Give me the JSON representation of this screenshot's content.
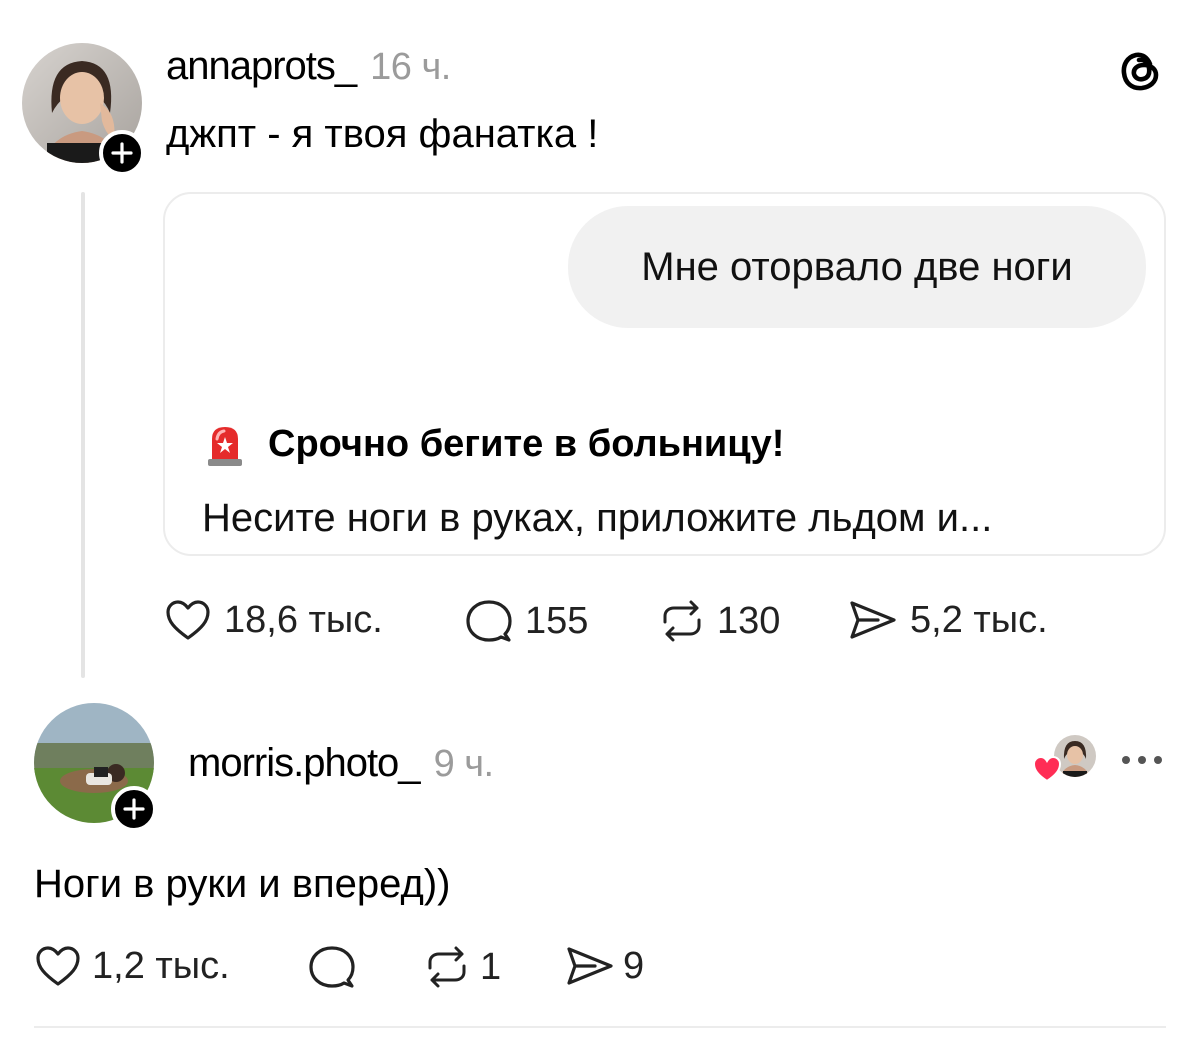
{
  "post": {
    "username": "annaprots_",
    "time": "16 ч.",
    "text": "джпт - я твоя фанатка !",
    "quote": {
      "user_message": "Мне оторвало две ноги",
      "answer_emoji": "🚨",
      "answer_title": "Срочно бегите в больницу!",
      "answer_body": "Несите ноги в руках, приложите льдом и..."
    },
    "actions": {
      "likes": "18,6 тыс.",
      "comments": "155",
      "reposts": "130",
      "shares": "5,2 тыс."
    }
  },
  "reply": {
    "username": "morris.photo_",
    "time": "9 ч.",
    "text": "Ноги в руки и вперед))",
    "actions": {
      "likes": "1,2 тыс.",
      "comments": "",
      "reposts": "1",
      "shares": "9"
    }
  },
  "icons": {
    "app_logo": "threads-logo-icon",
    "like": "heart-icon",
    "comment": "comment-bubble-icon",
    "repost": "repost-icon",
    "share": "send-icon",
    "more": "more-dots-icon",
    "follow": "plus-icon",
    "liked_by_author": "heart-badge-icon"
  },
  "colors": {
    "accent_heart": "#ff2d55",
    "muted_text": "#9b9b9b"
  }
}
